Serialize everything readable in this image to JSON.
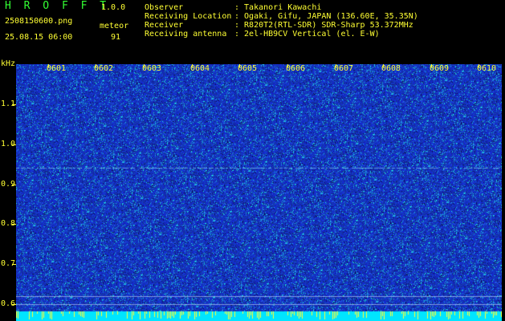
{
  "app": {
    "title": "H R O F F T",
    "version": "1.0.0",
    "filename": "2508150600.png",
    "datetime": "25.08.15 06:00",
    "meteor_label": "meteor",
    "meteor_count": "91"
  },
  "header": [
    {
      "label": "Observer",
      "value": ": Takanori Kawachi"
    },
    {
      "label": "Receiving Location",
      "value": ": Ogaki, Gifu, JAPAN (136.60E, 35.35N)"
    },
    {
      "label": "Receiver",
      "value": ": R820T2(RTL-SDR) SDR-Sharp 53.372MHz"
    },
    {
      "label": "Receiving antenna",
      "value": ": 2el-HB9CV Vertical (el. E-W)"
    }
  ],
  "axis": {
    "unit": "kHz",
    "y_ticks": [
      "1.1",
      "1.0",
      "0.9",
      "0.8",
      "0.7",
      "0.6"
    ],
    "x_ticks": [
      "0601",
      "0602",
      "0603",
      "0604",
      "0605",
      "0606",
      "0607",
      "0608",
      "0609",
      "0610"
    ]
  },
  "colors": {
    "background": "#000000",
    "text": "#ffff33",
    "title": "#33ff33",
    "spectro_base": "#1a2fbf",
    "noise_band": "#00e5ff"
  }
}
